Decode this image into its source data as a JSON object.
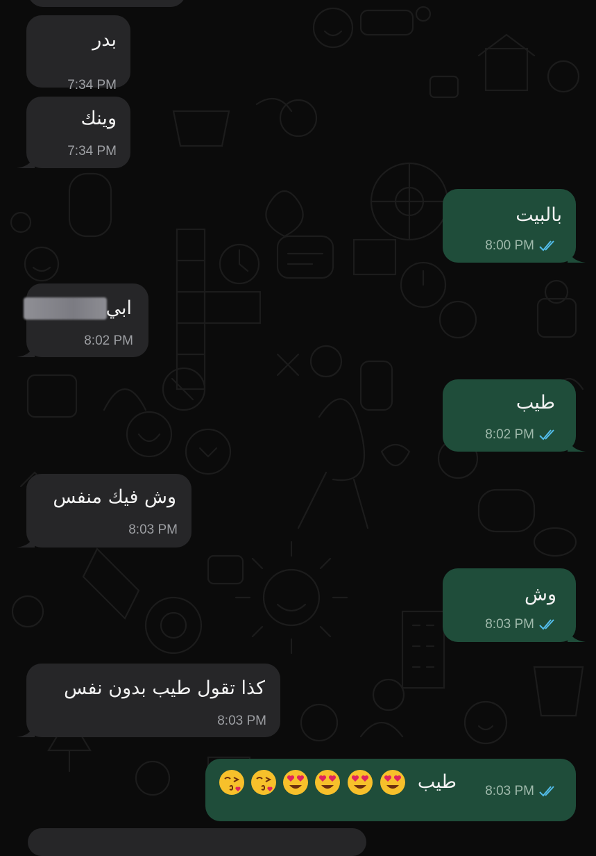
{
  "chat": {
    "messages": [
      {
        "id": "m1",
        "direction": "incoming",
        "text": "بدر",
        "time": "7:34 PM"
      },
      {
        "id": "m2",
        "direction": "incoming",
        "text": "وينك",
        "time": "7:34 PM"
      },
      {
        "id": "m3",
        "direction": "outgoing",
        "text": "بالبيت",
        "time": "8:00 PM",
        "status": "read"
      },
      {
        "id": "m4",
        "direction": "incoming",
        "text": "ابي",
        "time": "8:02 PM",
        "redacted_part": true
      },
      {
        "id": "m5",
        "direction": "outgoing",
        "text": "طيب",
        "time": "8:02 PM",
        "status": "read"
      },
      {
        "id": "m6",
        "direction": "incoming",
        "text": "وش فيك منفس",
        "time": "8:03 PM"
      },
      {
        "id": "m7",
        "direction": "outgoing",
        "text": "وش",
        "time": "8:03 PM",
        "status": "read"
      },
      {
        "id": "m8",
        "direction": "incoming",
        "text": "كذا تقول طيب بدون نفس",
        "time": "8:03 PM"
      },
      {
        "id": "m9",
        "direction": "outgoing",
        "text": "طيب",
        "time": "8:03 PM",
        "status": "read",
        "emojis": [
          "smiling-face-with-heart-eyes",
          "smiling-face-with-heart-eyes",
          "smiling-face-with-heart-eyes",
          "smiling-face-with-heart-eyes",
          "face-blowing-a-kiss",
          "face-blowing-a-kiss"
        ]
      }
    ]
  },
  "theme": {
    "background": "#0b0b0b",
    "incoming_bubble": "#262628",
    "outgoing_bubble": "#1f4d3a",
    "read_tick_color": "#53bdeb",
    "icons": [
      "double-check-icon",
      "bubble-tail-icon",
      "wallpaper-doodle-pattern"
    ]
  }
}
